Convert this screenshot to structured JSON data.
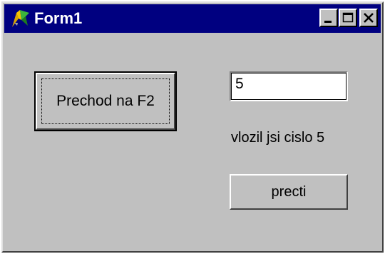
{
  "window": {
    "title": "Form1",
    "icon": "delphi-app-icon",
    "title_bar_color": "#000080",
    "face_color": "#c0c0c0"
  },
  "title_buttons": {
    "minimize_icon": "minimize-icon",
    "maximize_icon": "maximize-icon",
    "close_icon": "close-icon"
  },
  "form": {
    "prechod_button_label": "Prechod na F2",
    "input_value": "5",
    "info_label": "vlozil jsi cislo 5",
    "precti_button_label": "precti"
  }
}
